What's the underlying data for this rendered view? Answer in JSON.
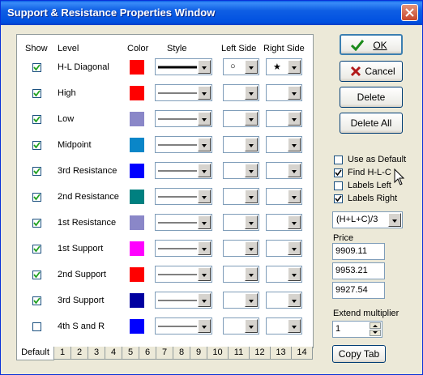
{
  "window": {
    "title": "Support & Resistance Properties Window"
  },
  "columns": {
    "show": "Show",
    "level": "Level",
    "color": "Color",
    "style": "Style",
    "left": "Left Side",
    "right": "Right Side"
  },
  "rows": [
    {
      "label": "H-L Diagonal",
      "checked": true,
      "color": "#ff0000",
      "thick": true,
      "left": "○",
      "right": "★"
    },
    {
      "label": "High",
      "checked": true,
      "color": "#ff0000",
      "thick": false,
      "left": "",
      "right": ""
    },
    {
      "label": "Low",
      "checked": true,
      "color": "#8a87c8",
      "thick": false,
      "left": "",
      "right": ""
    },
    {
      "label": "Midpoint",
      "checked": true,
      "color": "#0a86c8",
      "thick": false,
      "left": "",
      "right": ""
    },
    {
      "label": "3rd Resistance",
      "checked": true,
      "color": "#0000ff",
      "thick": false,
      "left": "",
      "right": ""
    },
    {
      "label": "2nd Resistance",
      "checked": true,
      "color": "#008080",
      "thick": false,
      "left": "",
      "right": ""
    },
    {
      "label": "1st Resistance",
      "checked": true,
      "color": "#8a87c8",
      "thick": false,
      "left": "",
      "right": ""
    },
    {
      "label": "1st Support",
      "checked": true,
      "color": "#ff00ff",
      "thick": false,
      "left": "",
      "right": ""
    },
    {
      "label": "2nd Support",
      "checked": true,
      "color": "#ff0000",
      "thick": false,
      "left": "",
      "right": ""
    },
    {
      "label": "3rd Support",
      "checked": true,
      "color": "#0000a0",
      "thick": false,
      "left": "",
      "right": ""
    },
    {
      "label": "4th S and R",
      "checked": false,
      "color": "#0000ff",
      "thick": false,
      "left": "",
      "right": ""
    }
  ],
  "tabs": [
    "Default",
    "1",
    "2",
    "3",
    "4",
    "5",
    "6",
    "7",
    "8",
    "9",
    "10",
    "11",
    "12",
    "13",
    "14"
  ],
  "buttons": {
    "ok": "OK",
    "cancel": "Cancel",
    "delete": "Delete",
    "delete_all": "Delete All",
    "copy_tab": "Copy Tab"
  },
  "options": [
    {
      "label": "Use as Default",
      "checked": false
    },
    {
      "label": "Find H-L-C",
      "checked": true
    },
    {
      "label": "Labels Left",
      "checked": false
    },
    {
      "label": "Labels Right",
      "checked": true
    }
  ],
  "formula": "(H+L+C)/3",
  "price_label": "Price",
  "prices": [
    "9909.11",
    "9953.21",
    "9927.54"
  ],
  "extend_label": "Extend multiplier",
  "extend_value": "1"
}
